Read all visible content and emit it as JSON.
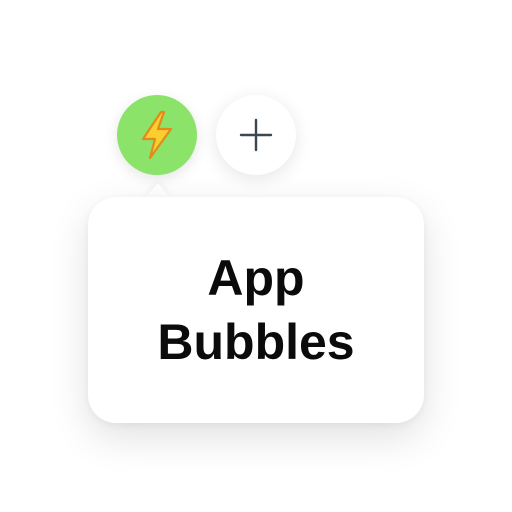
{
  "buttons": [
    {
      "icon": "lightning-icon",
      "glyph": "⚡",
      "background": "#8BE36A"
    },
    {
      "icon": "plus-icon",
      "glyph": "+",
      "background": "#ffffff"
    }
  ],
  "tooltip": {
    "line1": "App",
    "line2": "Bubbles"
  },
  "colors": {
    "accent": "#8BE36A",
    "bolt_fill": "#F8CF2E",
    "bolt_outline": "#E48A1B",
    "plus_stroke": "#3A4650",
    "text": "#0b0b0b"
  }
}
